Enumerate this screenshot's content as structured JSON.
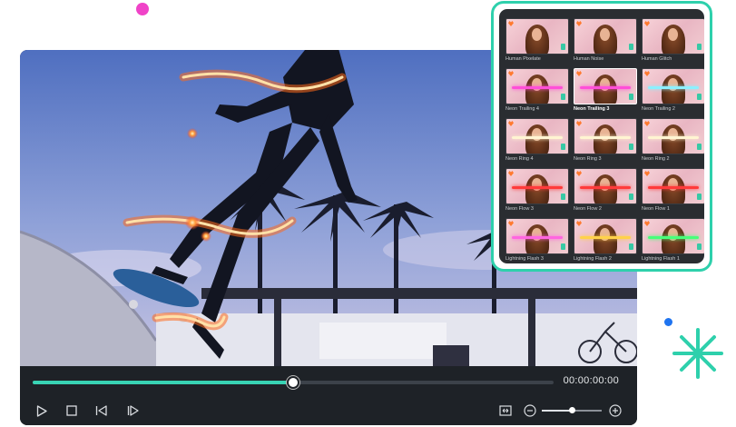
{
  "player": {
    "timecode": "00:00:00:00",
    "progress": 0.5
  },
  "controls": {
    "play_icon": "play-icon",
    "stop_icon": "stop-icon",
    "prev_frame_icon": "previous-frame-icon",
    "next_frame_icon": "next-frame-icon",
    "fit_icon": "fit-screen-icon",
    "zoom_out_icon": "zoom-out-icon",
    "zoom_in_icon": "zoom-in-icon",
    "zoom_level": 0.5
  },
  "effects": {
    "items": [
      {
        "label": "Human Pixelate",
        "glow": ""
      },
      {
        "label": "Human Noise",
        "glow": ""
      },
      {
        "label": "Human Glitch",
        "glow": ""
      },
      {
        "label": "Neon Trailing 4",
        "glow": "#ff4fd8"
      },
      {
        "label": "Neon Trailing 3",
        "glow": "#ff4fd8",
        "selected": true
      },
      {
        "label": "Neon Trailing 2",
        "glow": "#8cf0ff"
      },
      {
        "label": "Neon Ring 4",
        "glow": "#fff5d2"
      },
      {
        "label": "Neon Ring 3",
        "glow": "#fff5d2"
      },
      {
        "label": "Neon Ring 2",
        "glow": "#fff5d2"
      },
      {
        "label": "Neon Flow 3",
        "glow": "#ff3b3b"
      },
      {
        "label": "Neon Flow 2",
        "glow": "#ff3b3b"
      },
      {
        "label": "Neon Flow 1",
        "glow": "#ff3b3b"
      },
      {
        "label": "Lightning Flash 3",
        "glow": "#ff66e0"
      },
      {
        "label": "Lightning Flash 2",
        "glow": "#ffd24a"
      },
      {
        "label": "Lightning Flash 1",
        "glow": "#48ff7a"
      }
    ]
  },
  "colors": {
    "accent": "#2ed0ac",
    "progress": "#38d3b4",
    "panel_bg": "#2a2d31",
    "player_bar": "#1e2227"
  }
}
